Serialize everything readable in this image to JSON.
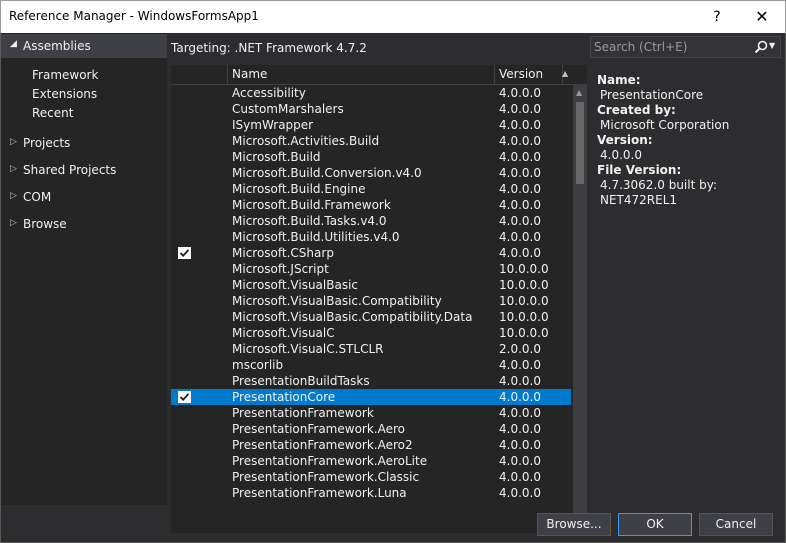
{
  "window": {
    "title": "Reference Manager - WindowsFormsApp1",
    "help_label": "?",
    "close_label": "✕"
  },
  "sidebar": {
    "header": "Assemblies",
    "sub_items": [
      "Framework",
      "Extensions",
      "Recent"
    ],
    "nodes": [
      "Projects",
      "Shared Projects",
      "COM",
      "Browse"
    ]
  },
  "targeting": "Targeting: .NET Framework 4.7.2",
  "search": {
    "placeholder": "Search (Ctrl+E)",
    "value": ""
  },
  "grid": {
    "columns": {
      "check": "",
      "name": "Name",
      "version": "Version"
    },
    "rows": [
      {
        "name": "Accessibility",
        "version": "4.0.0.0",
        "checked": false,
        "selected": false
      },
      {
        "name": "CustomMarshalers",
        "version": "4.0.0.0",
        "checked": false,
        "selected": false
      },
      {
        "name": "ISymWrapper",
        "version": "4.0.0.0",
        "checked": false,
        "selected": false
      },
      {
        "name": "Microsoft.Activities.Build",
        "version": "4.0.0.0",
        "checked": false,
        "selected": false
      },
      {
        "name": "Microsoft.Build",
        "version": "4.0.0.0",
        "checked": false,
        "selected": false
      },
      {
        "name": "Microsoft.Build.Conversion.v4.0",
        "version": "4.0.0.0",
        "checked": false,
        "selected": false
      },
      {
        "name": "Microsoft.Build.Engine",
        "version": "4.0.0.0",
        "checked": false,
        "selected": false
      },
      {
        "name": "Microsoft.Build.Framework",
        "version": "4.0.0.0",
        "checked": false,
        "selected": false
      },
      {
        "name": "Microsoft.Build.Tasks.v4.0",
        "version": "4.0.0.0",
        "checked": false,
        "selected": false
      },
      {
        "name": "Microsoft.Build.Utilities.v4.0",
        "version": "4.0.0.0",
        "checked": false,
        "selected": false
      },
      {
        "name": "Microsoft.CSharp",
        "version": "4.0.0.0",
        "checked": true,
        "selected": false
      },
      {
        "name": "Microsoft.JScript",
        "version": "10.0.0.0",
        "checked": false,
        "selected": false
      },
      {
        "name": "Microsoft.VisualBasic",
        "version": "10.0.0.0",
        "checked": false,
        "selected": false
      },
      {
        "name": "Microsoft.VisualBasic.Compatibility",
        "version": "10.0.0.0",
        "checked": false,
        "selected": false
      },
      {
        "name": "Microsoft.VisualBasic.Compatibility.Data",
        "version": "10.0.0.0",
        "checked": false,
        "selected": false
      },
      {
        "name": "Microsoft.VisualC",
        "version": "10.0.0.0",
        "checked": false,
        "selected": false
      },
      {
        "name": "Microsoft.VisualC.STLCLR",
        "version": "2.0.0.0",
        "checked": false,
        "selected": false
      },
      {
        "name": "mscorlib",
        "version": "4.0.0.0",
        "checked": false,
        "selected": false
      },
      {
        "name": "PresentationBuildTasks",
        "version": "4.0.0.0",
        "checked": false,
        "selected": false
      },
      {
        "name": "PresentationCore",
        "version": "4.0.0.0",
        "checked": true,
        "selected": true
      },
      {
        "name": "PresentationFramework",
        "version": "4.0.0.0",
        "checked": false,
        "selected": false
      },
      {
        "name": "PresentationFramework.Aero",
        "version": "4.0.0.0",
        "checked": false,
        "selected": false
      },
      {
        "name": "PresentationFramework.Aero2",
        "version": "4.0.0.0",
        "checked": false,
        "selected": false
      },
      {
        "name": "PresentationFramework.AeroLite",
        "version": "4.0.0.0",
        "checked": false,
        "selected": false
      },
      {
        "name": "PresentationFramework.Classic",
        "version": "4.0.0.0",
        "checked": false,
        "selected": false
      },
      {
        "name": "PresentationFramework.Luna",
        "version": "4.0.0.0",
        "checked": false,
        "selected": false
      }
    ]
  },
  "details": {
    "name_label": "Name:",
    "name_value": "PresentationCore",
    "created_label": "Created by:",
    "created_value": "Microsoft Corporation",
    "version_label": "Version:",
    "version_value": "4.0.0.0",
    "file_version_label": "File Version:",
    "file_version_value": "4.7.3062.0 built by: NET472REL1"
  },
  "buttons": {
    "browse": "Browse...",
    "ok": "OK",
    "cancel": "Cancel"
  },
  "colors": {
    "selection": "#007acc",
    "background": "#2d2d30",
    "panel": "#252526"
  },
  "icons": {
    "search": "search-icon",
    "checkbox": "checkmark-icon"
  }
}
